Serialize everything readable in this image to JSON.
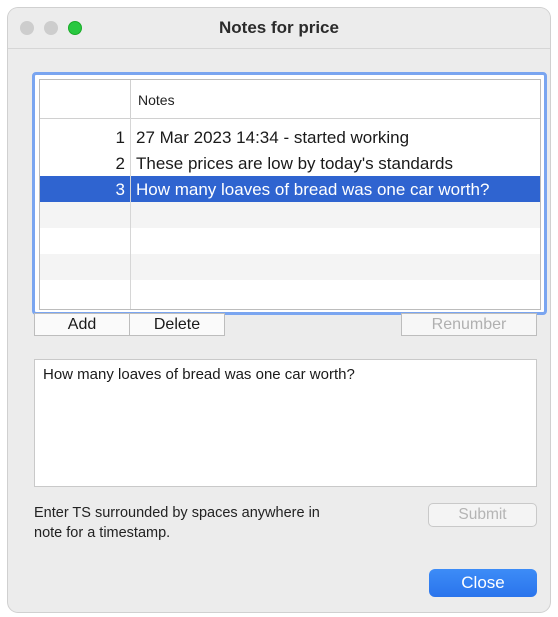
{
  "window": {
    "title": "Notes for price"
  },
  "table": {
    "header": "Notes",
    "rows": [
      {
        "num": "1",
        "text": "27 Mar 2023 14:34 - started working"
      },
      {
        "num": "2",
        "text": "These prices are low by today's standards"
      },
      {
        "num": "3",
        "text": "How many loaves of bread was one car worth?"
      }
    ],
    "selected_row": "3"
  },
  "buttons": {
    "add": "Add",
    "delete": "Delete",
    "renumber": "Renumber",
    "submit": "Submit",
    "close": "Close"
  },
  "editor": {
    "value": "How many loaves of bread was one car worth?"
  },
  "hint": {
    "line1": "Enter TS surrounded by spaces anywhere in",
    "line2": "note for a timestamp."
  },
  "colors": {
    "selection": "#2f64d0",
    "focus_ring": "#7aa5f0",
    "close_button": "#2a74ec",
    "zoom_button": "#29c840"
  }
}
